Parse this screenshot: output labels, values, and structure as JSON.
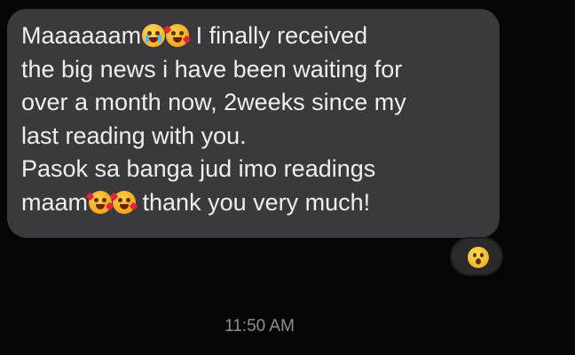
{
  "message": {
    "lines": [
      {
        "before": "Maaaaaam",
        "after": " I finally received"
      },
      {
        "text": "the big news i have been waiting for"
      },
      {
        "text": "over a month now, 2weeks since my"
      },
      {
        "text": "last reading with you."
      },
      {
        "text": "Pasok sa banga jud imo readings"
      },
      {
        "before": "maam",
        "after": " thank you very much!"
      }
    ],
    "emoji_line1": [
      "crying-face-emoji",
      "smiling-face-with-hearts-emoji"
    ],
    "emoji_line6": [
      "smiling-face-with-hearts-emoji",
      "smiling-face-with-hearts-emoji"
    ]
  },
  "reaction": {
    "icon": "astonished-face-emoji"
  },
  "timestamp": "11:50 AM",
  "colors": {
    "background": "#060606",
    "bubble": "#3a3a3c",
    "text": "#eeeeee",
    "timestamp": "#8f8f8f"
  }
}
